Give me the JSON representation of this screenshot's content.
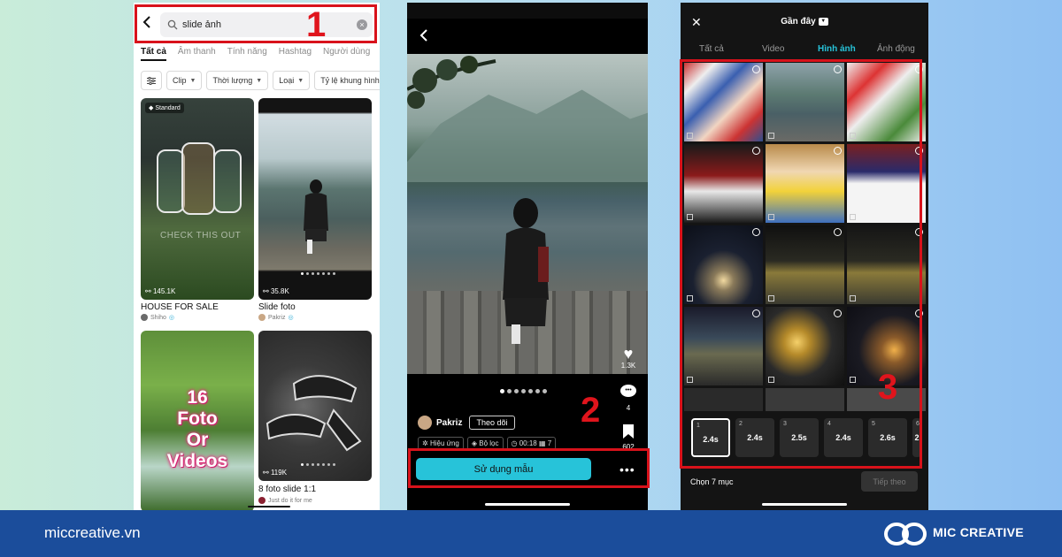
{
  "phone1": {
    "search": {
      "query": "slide ảnh"
    },
    "tabs": [
      "Tất cả",
      "Âm thanh",
      "Tính năng",
      "Hashtag",
      "Người dùng"
    ],
    "filters": [
      "Clip",
      "Thời lượng",
      "Loại",
      "Tỷ lệ khung hình"
    ],
    "cards": [
      {
        "badge": "Standard",
        "overlay": "CHECK THIS OUT",
        "stat": "145.1K",
        "title": "HOUSE FOR SALE",
        "author": "Shiho"
      },
      {
        "stat": "35.8K",
        "title": "Slide foto",
        "author": "Pakriz"
      },
      {
        "overlay_lines": [
          "16",
          "Foto",
          "Or",
          "Videos"
        ]
      },
      {
        "stat": "119K",
        "title": "8 foto slide 1:1",
        "author": "Just do it for me"
      }
    ],
    "step": "1"
  },
  "phone2": {
    "likes": "1.3K",
    "comments": "4",
    "saves": "602",
    "author": "Pakriz",
    "follow_label": "Theo dõi",
    "meta": {
      "effects": "Hiệu ứng",
      "filters": "Bộ lọc",
      "duration": "00:18",
      "clips": "7"
    },
    "use_template_label": "Sử dụng mẫu",
    "more": "•••",
    "step": "2"
  },
  "phone3": {
    "title": "Gần đây",
    "tabs": [
      "Tất cả",
      "Video",
      "Hình ảnh",
      "Ảnh động"
    ],
    "active_tab": "Hình ảnh",
    "slots": [
      {
        "index": "1",
        "duration": "2.4s"
      },
      {
        "index": "2",
        "duration": "2.4s"
      },
      {
        "index": "3",
        "duration": "2.5s"
      },
      {
        "index": "4",
        "duration": "2.4s"
      },
      {
        "index": "5",
        "duration": "2.6s"
      },
      {
        "index": "6",
        "duration": "2"
      }
    ],
    "selected_count": "Chọn 7 mục",
    "next_label": "Tiếp theo",
    "step": "3"
  },
  "footer": {
    "website": "miccreative.vn",
    "brand": "MIC CREATIVE"
  },
  "colors": {
    "accent": "#27c3d9",
    "highlight": "#d8121b",
    "footer_bg": "#1b4d9b"
  }
}
